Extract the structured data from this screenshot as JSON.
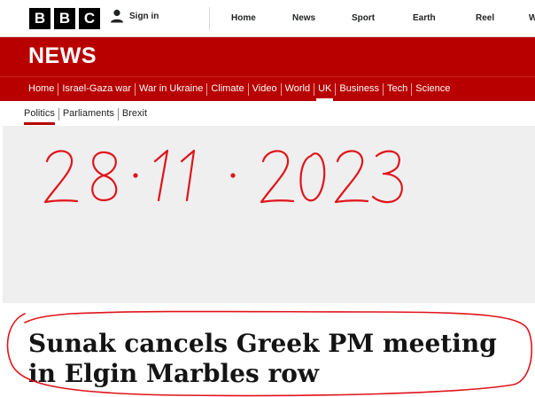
{
  "masthead": {
    "logo_letters": [
      "B",
      "B",
      "C"
    ],
    "signin_label": "Sign in",
    "nav": [
      "Home",
      "News",
      "Sport",
      "Earth",
      "Reel",
      "W"
    ]
  },
  "news": {
    "title": "NEWS",
    "subnav": [
      "Home",
      "Israel-Gaza war",
      "War in Ukraine",
      "Climate",
      "Video",
      "World",
      "UK",
      "Business",
      "Tech",
      "Science"
    ],
    "active": "UK"
  },
  "section_nav": {
    "items": [
      "Politics",
      "Parliaments",
      "Brexit"
    ],
    "active": "Politics"
  },
  "annotation": {
    "date_text": "28·11·2023",
    "ink_color": "#e0141b"
  },
  "article": {
    "headline": "Sunak cancels Greek PM meeting in Elgin Marbles row"
  },
  "colors": {
    "brand_red": "#b80000",
    "text": "#141414"
  }
}
